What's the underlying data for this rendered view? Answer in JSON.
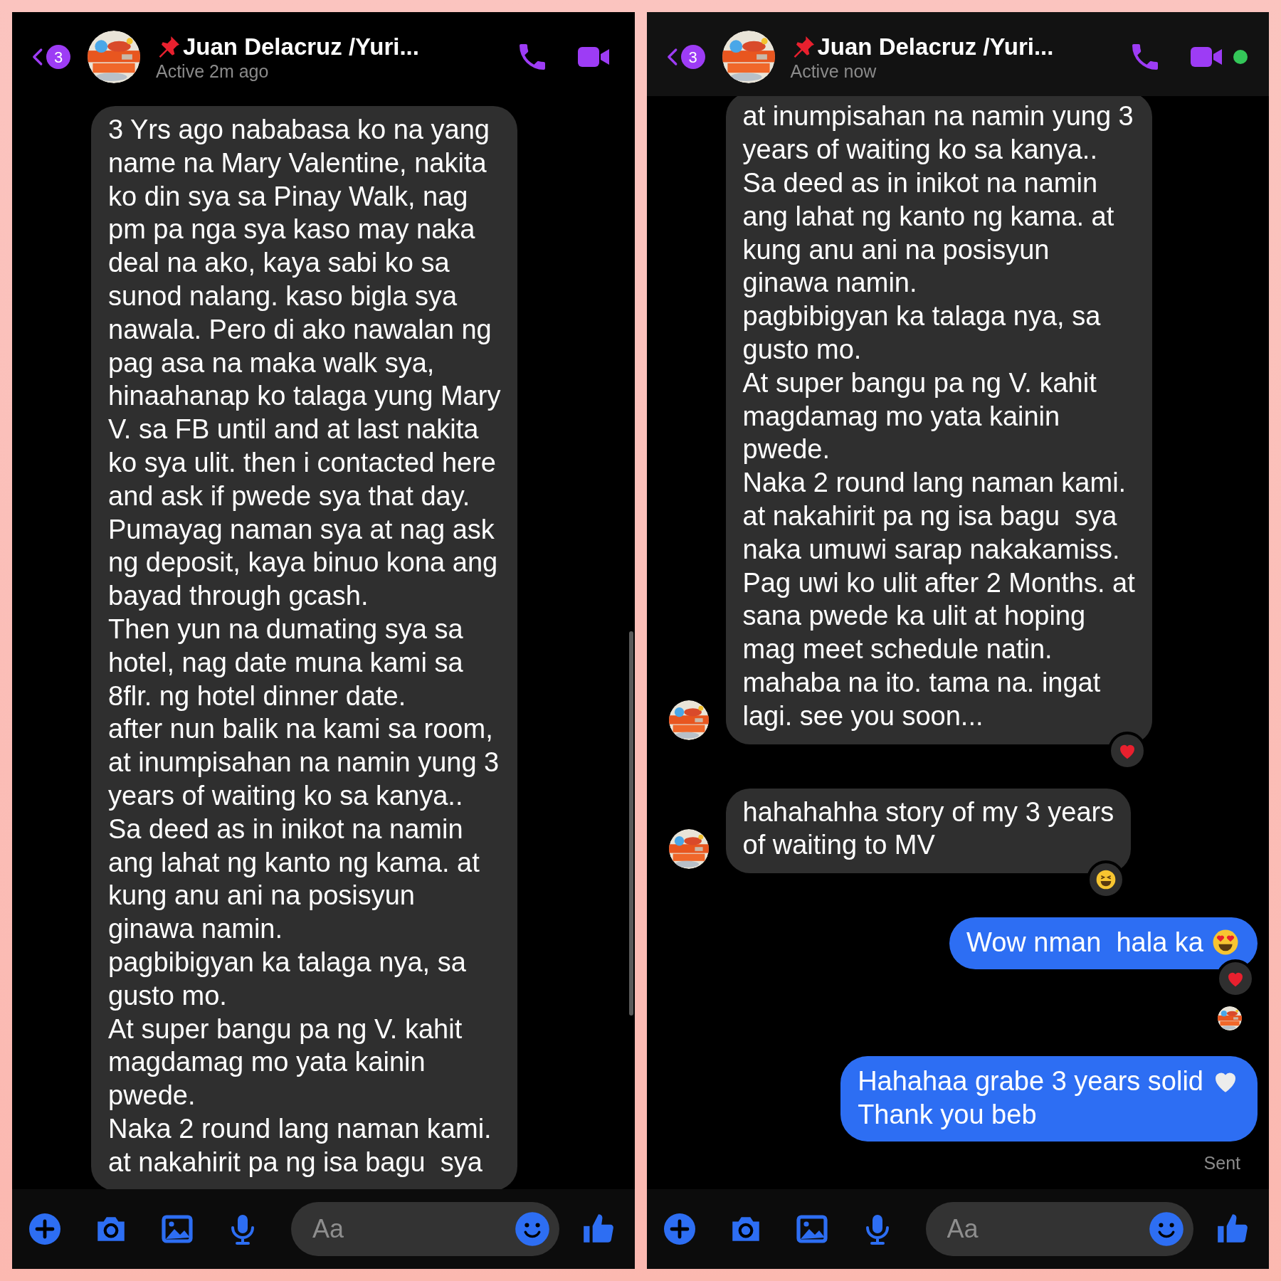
{
  "panels": [
    {
      "header": {
        "badge": "3",
        "title": "Juan Delacruz /Yuri...",
        "status": "Active 2m ago",
        "online": false
      },
      "messages": [
        {
          "kind": "incoming",
          "avatar": false,
          "text": "3 Yrs ago nababasa ko na yang\nname na Mary Valentine, nakita\nko din sya sa Pinay Walk, nag\npm pa nga sya kaso may naka\ndeal na ako, kaya sabi ko sa\nsunod nalang. kaso bigla sya\nnawala. Pero di ako nawalan ng\npag asa na maka walk sya,\nhinaahanap ko talaga yung Mary\nV. sa FB until and at last nakita\nko sya ulit. then i contacted here\nand ask if pwede sya that day.\nPumayag naman sya at nag ask\nng deposit, kaya binuo kona ang\nbayad through gcash.\nThen yun na dumating sya sa\nhotel, nag date muna kami sa\n8flr. ng hotel dinner date.\nafter nun balik na kami sa room,\nat inumpisahan na namin yung 3\nyears of waiting ko sa kanya..\nSa deed as in inikot na namin\nang lahat ng kanto ng kama. at\nkung anu ani na posisyun\nginawa namin.\npagbibigyan ka talaga nya, sa\ngusto mo.\nAt super bangu pa ng V. kahit\nmagdamag mo yata kainin\npwede.\nNaka 2 round lang naman kami.\nat nakahirit pa ng isa bagu  sya"
        }
      ],
      "composer": {
        "placeholder": "Aa"
      }
    },
    {
      "header": {
        "badge": "3",
        "title": "Juan Delacruz /Yuri...",
        "status": "Active now",
        "online": true
      },
      "messages": [
        {
          "kind": "incoming",
          "avatar": true,
          "reaction": {
            "kind": "heart"
          },
          "text": "at inumpisahan na namin yung 3\nyears of waiting ko sa kanya..\nSa deed as in inikot na namin\nang lahat ng kanto ng kama. at\nkung anu ani na posisyun\nginawa namin.\npagbibigyan ka talaga nya, sa\ngusto mo.\nAt super bangu pa ng V. kahit\nmagdamag mo yata kainin\npwede.\nNaka 2 round lang naman kami.\nat nakahirit pa ng isa bagu  sya\nnaka umuwi sarap nakakamiss.\nPag uwi ko ulit after 2 Months. at\nsana pwede ka ulit at hoping\nmag meet schedule natin.\nmahaba na ito. tama na. ingat\nlagi. see you soon..."
        },
        {
          "kind": "incoming",
          "avatar": true,
          "reaction": {
            "kind": "laugh"
          },
          "text": "hahahahha story of my 3 years\nof waiting to MV"
        },
        {
          "kind": "outgoing",
          "reaction": {
            "kind": "heart"
          },
          "emoji": {
            "kind": "heart_eyes"
          },
          "seen_avatar": true,
          "text": "Wow nman  hala ka"
        },
        {
          "kind": "outgoing",
          "emoji": {
            "kind": "white_heart"
          },
          "seen_avatar": false,
          "receipt": "Sent",
          "text": "Hahahaa grabe 3 years solid\nThank you beb"
        }
      ],
      "composer": {
        "placeholder": "Aa"
      }
    }
  ]
}
